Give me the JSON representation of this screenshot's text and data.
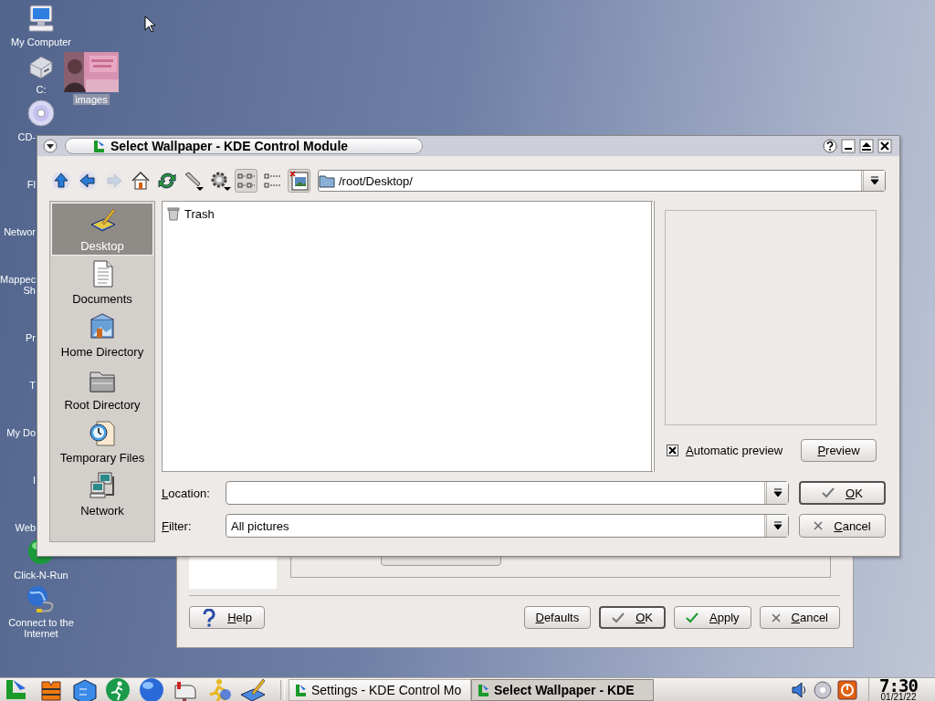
{
  "desktop": {
    "icons": [
      {
        "label": "My Computer",
        "kind": "full"
      },
      {
        "label": "C:",
        "kind": "full"
      },
      {
        "label": "CD-",
        "kind": "edge"
      },
      {
        "label": "Fl",
        "kind": "cut"
      },
      {
        "label": "Networ",
        "kind": "cut"
      },
      {
        "label": "Mappec\nSh",
        "kind": "cut"
      },
      {
        "label": "Pr",
        "kind": "cut"
      },
      {
        "label": "T",
        "kind": "cut"
      },
      {
        "label": "My Do",
        "kind": "cut"
      },
      {
        "label": "I",
        "kind": "cut"
      },
      {
        "label": "Web",
        "kind": "cut"
      },
      {
        "label": "Click-N-Run",
        "kind": "full"
      },
      {
        "label": "Connect to the\nInternet",
        "kind": "full"
      }
    ],
    "images": {
      "label": "images",
      "selected": true
    }
  },
  "settings_window": {
    "buttons": [
      {
        "label": "Help",
        "default": false
      },
      {
        "label": "Defaults",
        "default": false
      },
      {
        "label": "OK",
        "default": true
      },
      {
        "label": "Apply",
        "default": false
      },
      {
        "label": "Cancel",
        "default": false
      }
    ]
  },
  "dialog": {
    "title": "Select Wallpaper - KDE Control Module",
    "toolbar": [
      {
        "disabled": false,
        "pressed": false
      },
      {
        "disabled": false,
        "pressed": false
      },
      {
        "disabled": true,
        "pressed": false
      },
      {
        "disabled": false,
        "pressed": false
      },
      {
        "disabled": false,
        "pressed": false
      },
      {
        "disabled": false,
        "pressed": false
      },
      {
        "disabled": false,
        "pressed": false
      },
      {
        "disabled": false,
        "pressed": true
      },
      {
        "disabled": false,
        "pressed": false
      },
      {
        "disabled": false,
        "pressed": true
      }
    ],
    "path": "/root/Desktop/",
    "places": [
      {
        "label": "Desktop",
        "selected": true
      },
      {
        "label": "Documents",
        "selected": false
      },
      {
        "label": "Home Directory",
        "selected": false
      },
      {
        "label": "Root Directory",
        "selected": false
      },
      {
        "label": "Temporary Files",
        "selected": false
      },
      {
        "label": "Network",
        "selected": false
      }
    ],
    "files": [
      {
        "name": "Trash"
      }
    ],
    "automatic_preview": {
      "label": "Automatic preview",
      "checked": true
    },
    "preview_button": "Preview",
    "location": {
      "label": "Location:"
    },
    "filter": {
      "label": "Filter:",
      "value": "All pictures"
    },
    "buttons": [
      {
        "label": "OK",
        "default": true
      },
      {
        "label": "Cancel",
        "default": false
      }
    ]
  },
  "taskbar": {
    "tasks": [
      {
        "title": "Settings - KDE Control Mo",
        "selected": false
      },
      {
        "title": "Select Wallpaper - KDE",
        "selected": true
      }
    ],
    "clock": {
      "time": "7:30",
      "date": "01/21/22"
    }
  }
}
